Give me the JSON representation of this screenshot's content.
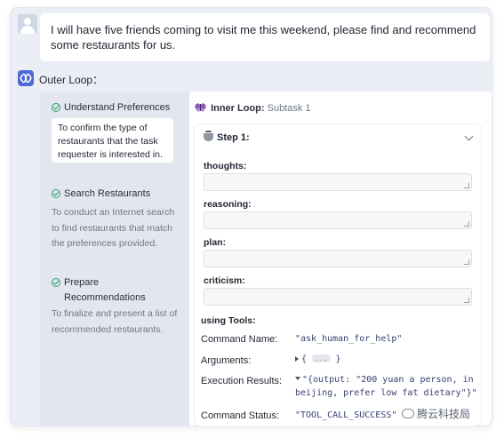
{
  "user_message": "I will have five friends coming to visit me this weekend, please find and recommend some restaurants for us.",
  "outer_loop": {
    "label": "Outer Loop：",
    "steps": [
      {
        "title": "Understand Preferences",
        "description": "To confirm the type of restaurants that the task requester is interested in.",
        "status": "done"
      },
      {
        "title": "Search Restaurants",
        "description": "To conduct an Internet search to find restaurants that match the preferences provided.",
        "status": "done"
      },
      {
        "title": "Prepare Recommendations",
        "description": "To finalize and present a list of recommended restaurants.",
        "status": "done"
      }
    ]
  },
  "inner_loop": {
    "title": "Inner Loop:",
    "subtask": "Subtask 1",
    "step_label": "Step 1:",
    "fields": [
      {
        "label": "thoughts:",
        "value": ""
      },
      {
        "label": "reasoning:",
        "value": ""
      },
      {
        "label": "plan:",
        "value": ""
      },
      {
        "label": "criticism:",
        "value": ""
      }
    ],
    "tools_label": "using Tools:",
    "command_name_label": "Command Name:",
    "command_name_value": "\"ask_human_for_help\"",
    "arguments_label": "Arguments:",
    "arguments_value": "{",
    "arguments_collapsed": "...",
    "arguments_close": "}",
    "execution_results_label": "Execution Results:",
    "execution_results_line1": "\"{output: \"200 yuan a person, in",
    "execution_results_line2": "beijing, prefer low fat dietary\"}\"",
    "command_status_label": "Command Status:",
    "command_status_value": "\"TOOL_CALL_SUCCESS\""
  },
  "watermark": "腾云科技局",
  "colors": {
    "accent": "#4e6ad8",
    "check": "#29a36a",
    "code": "#354270"
  }
}
